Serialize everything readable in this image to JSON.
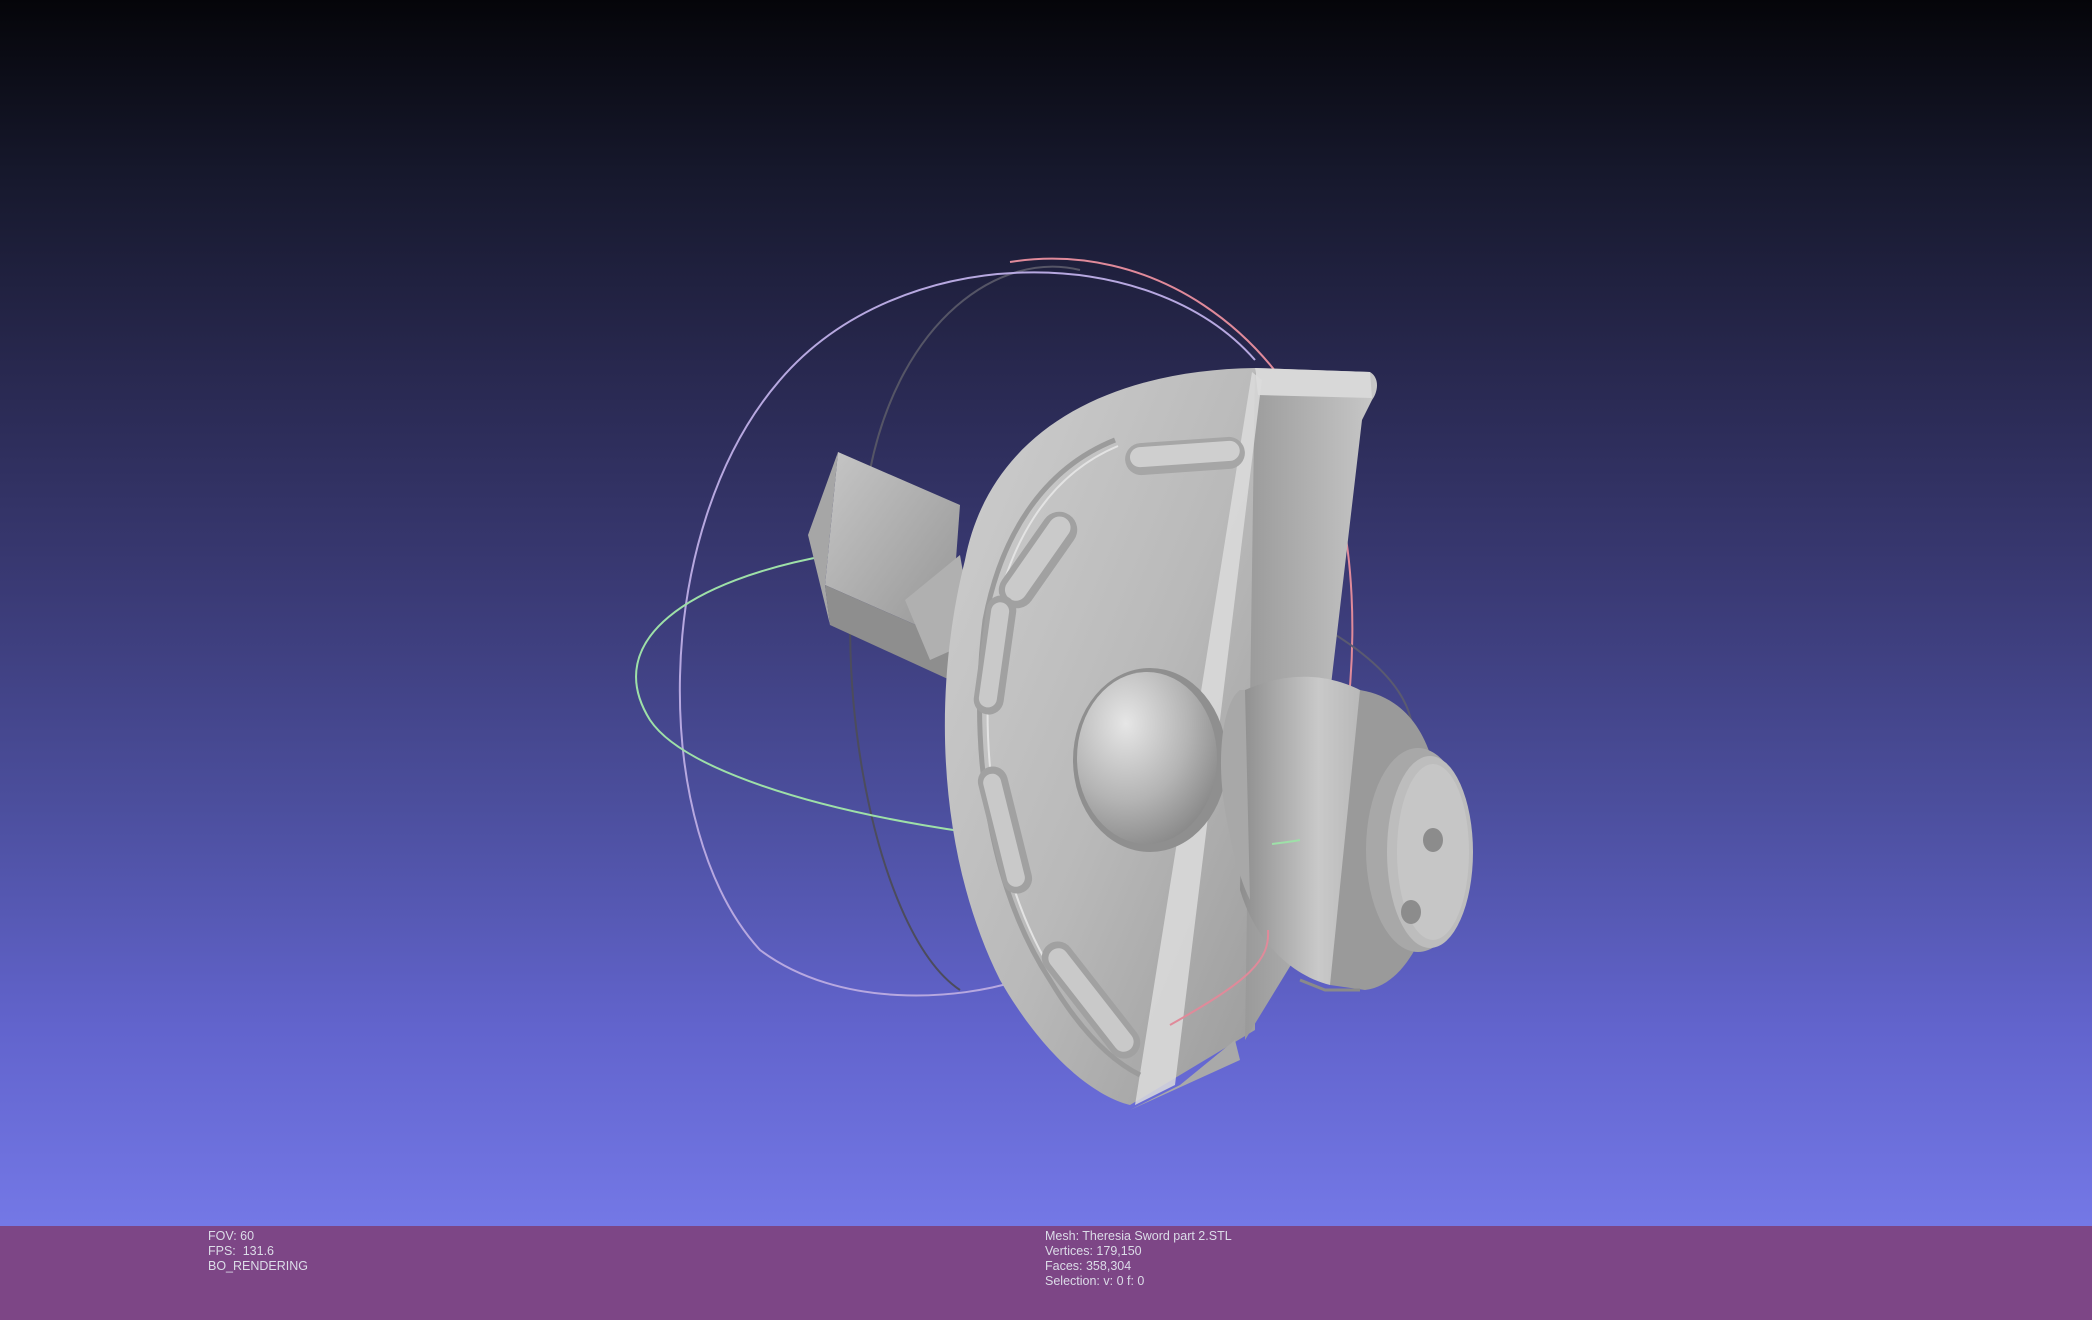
{
  "viewer": {
    "render_info": {
      "fov": "FOV: 60",
      "fps": "FPS:  131.6",
      "mode": "BO_RENDERING"
    },
    "mesh_info": {
      "mesh": "Mesh: Theresia Sword part 2.STL",
      "vertices": "Vertices: 179,150",
      "faces": "Faces: 358,304",
      "selection": "Selection: v: 0 f: 0"
    }
  },
  "colors": {
    "background_top": "#050509",
    "background_bottom": "#7478e6",
    "status_bar": "#7d4686",
    "model": "#bdbdbd",
    "gizmo_x": "#e08a9a",
    "gizmo_y": "#9ee0a8",
    "gizmo_z": "#b7a8e0",
    "gizmo_dark": "#4a4a5a"
  },
  "icons": {
    "trackball": "trackball-gizmo-icon"
  }
}
